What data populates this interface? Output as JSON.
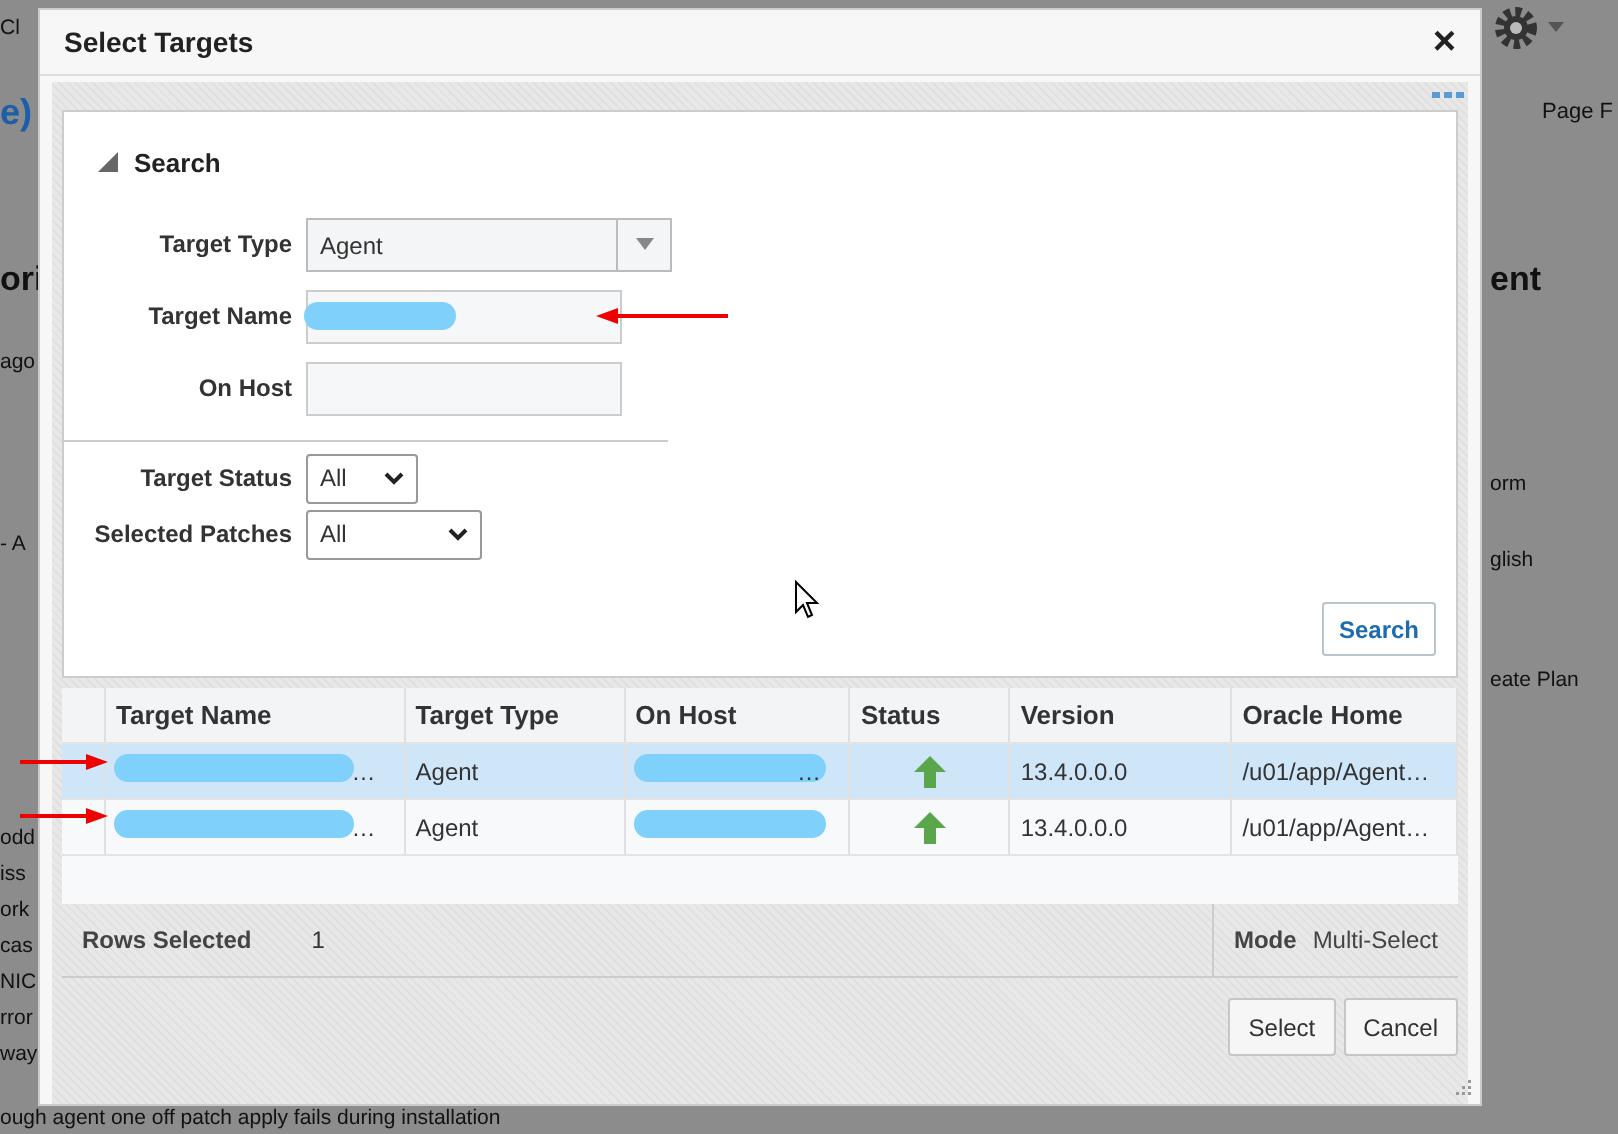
{
  "background_page": {
    "texts": [
      {
        "text": "Cl",
        "kind": "plain"
      },
      {
        "text": "e)",
        "kind": "heading-link"
      },
      {
        "text": "Page F",
        "kind": "small"
      },
      {
        "text": "ori",
        "kind": "heading"
      },
      {
        "text": "ago",
        "kind": "plain"
      },
      {
        "text": "- A",
        "kind": "plain"
      },
      {
        "text": "ent",
        "kind": "heading"
      },
      {
        "text": "orm",
        "kind": "plain"
      },
      {
        "text": "glish",
        "kind": "plain"
      },
      {
        "text": "eate Plan",
        "kind": "plain"
      },
      {
        "text": "odd",
        "kind": "plain"
      },
      {
        "text": "iss",
        "kind": "plain"
      },
      {
        "text": "ork",
        "kind": "plain"
      },
      {
        "text": "cas",
        "kind": "plain"
      },
      {
        "text": "NIC",
        "kind": "plain"
      },
      {
        "text": "rror",
        "kind": "plain"
      },
      {
        "text": "way",
        "kind": "plain"
      },
      {
        "text": "ough agent one off patch apply fails during installation",
        "kind": "plain"
      }
    ]
  },
  "dialog": {
    "title": "Select Targets",
    "close": "×",
    "search": {
      "heading": "Search",
      "expanded": true,
      "fields": [
        {
          "label": "Target Type",
          "kind": "combo",
          "value": "Agent",
          "redacted": false,
          "annotated": false
        },
        {
          "label": "Target Name",
          "kind": "text",
          "redacted": true,
          "annotated": true
        },
        {
          "label": "On Host",
          "kind": "text",
          "redacted": false,
          "annotated": false
        }
      ],
      "filters": [
        {
          "label": "Target Status",
          "value": "All"
        },
        {
          "label": "Selected Patches",
          "value": "All"
        }
      ],
      "button": "Search"
    },
    "table": {
      "columns": [
        "Target Name",
        "Target Type",
        "On Host",
        "Status",
        "Version",
        "Oracle Home"
      ],
      "rows": [
        {
          "selected": true,
          "annotated": true,
          "target_name": "…",
          "target_type": "Agent",
          "on_host": "…",
          "version": "13.4.0.0.0",
          "oracle_home": "/u01/app/Agent…"
        },
        {
          "selected": false,
          "annotated": true,
          "target_name": "…",
          "target_type": "Agent",
          "version": "13.4.0.0.0",
          "oracle_home": "/u01/app/Agent…"
        }
      ]
    },
    "footer": {
      "rows_selected_label": "Rows Selected",
      "rows_selected": "1",
      "mode_label": "Mode",
      "mode": "Multi-Select"
    },
    "buttons": [
      "Select",
      "Cancel"
    ]
  }
}
